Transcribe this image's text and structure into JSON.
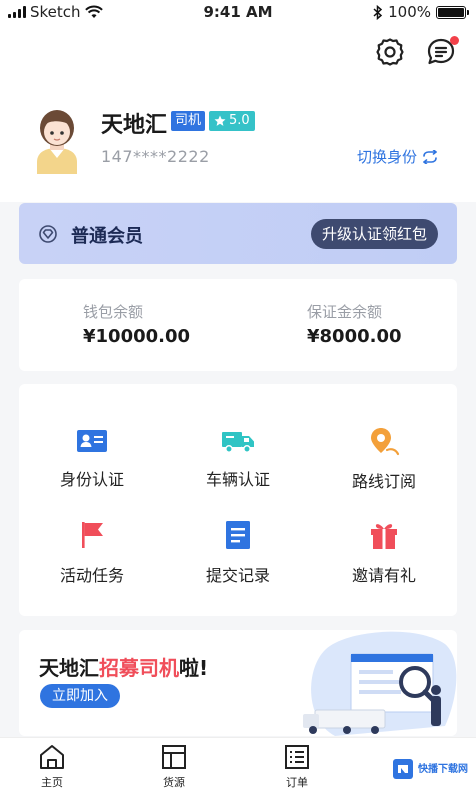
{
  "status_bar": {
    "carrier": "Sketch",
    "time": "9:41 AM",
    "battery": "100%"
  },
  "profile": {
    "name": "天地汇",
    "role": "司机",
    "rating": "5.0",
    "phone": "147****2222",
    "switch_label": "切换身份"
  },
  "membership": {
    "level": "普通会员",
    "upgrade_label": "升级认证领红包"
  },
  "wallet": {
    "balance_label": "钱包余额",
    "balance_value": "¥10000.00",
    "deposit_label": "保证金余额",
    "deposit_value": "¥8000.00"
  },
  "grid": [
    {
      "label": "身份认证",
      "icon": "id-card-icon",
      "color": "#2f74e0"
    },
    {
      "label": "车辆认证",
      "icon": "truck-icon",
      "color": "#2fc4c4"
    },
    {
      "label": "路线订阅",
      "icon": "route-pin-icon",
      "color": "#f3a03a"
    },
    {
      "label": "活动任务",
      "icon": "flag-icon",
      "color": "#f04e5a"
    },
    {
      "label": "提交记录",
      "icon": "document-icon",
      "color": "#2f74e0"
    },
    {
      "label": "邀请有礼",
      "icon": "gift-icon",
      "color": "#f04e5a"
    }
  ],
  "banner": {
    "title_prefix": "天地汇",
    "title_highlight": "招募司机",
    "title_suffix": "啦!",
    "join_label": "立即加入"
  },
  "tabs": [
    {
      "label": "主页",
      "icon": "home-icon"
    },
    {
      "label": "货源",
      "icon": "cargo-icon"
    },
    {
      "label": "订单",
      "icon": "order-list-icon"
    }
  ],
  "watermark": {
    "line1": "快播下载网"
  },
  "colors": {
    "accent": "#2f74e0",
    "highlight": "#f04e5a",
    "teal": "#35c2c8",
    "member_card": "#c4cff5",
    "upgrade_button": "#3e4a70"
  }
}
